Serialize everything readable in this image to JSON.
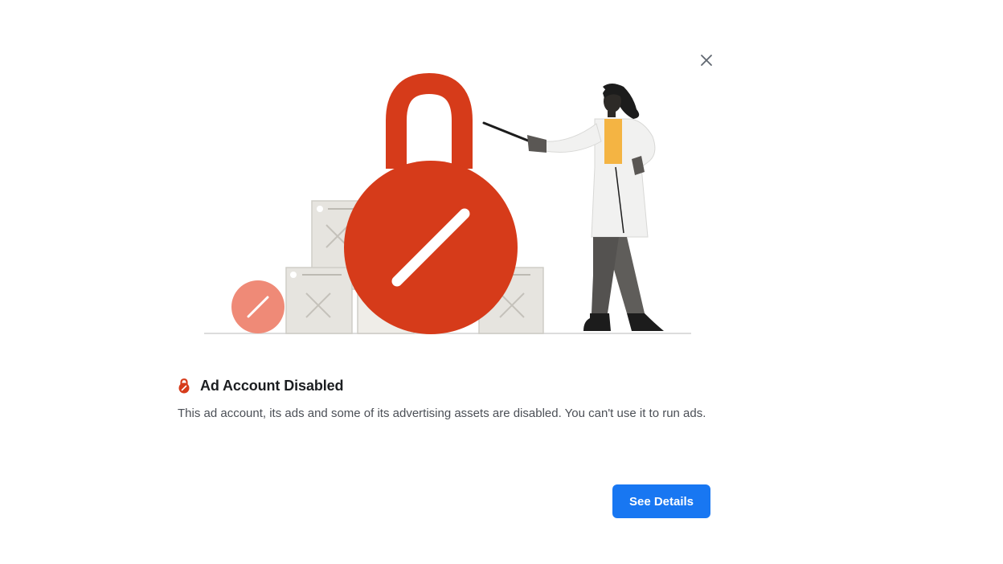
{
  "dialog": {
    "title": "Ad Account Disabled",
    "title_icon": "lock-icon",
    "description": "This ad account, its ads and some of its advertising assets are disabled. You can't use it to run ads.",
    "primary_button_label": "See Details",
    "close_icon": "close-icon"
  },
  "colors": {
    "accent": "#1877f2",
    "lock_red": "#d63b1a",
    "soft_red": "#ef8a77",
    "title_text": "#1c1e21",
    "body_text": "#4b4f56"
  }
}
